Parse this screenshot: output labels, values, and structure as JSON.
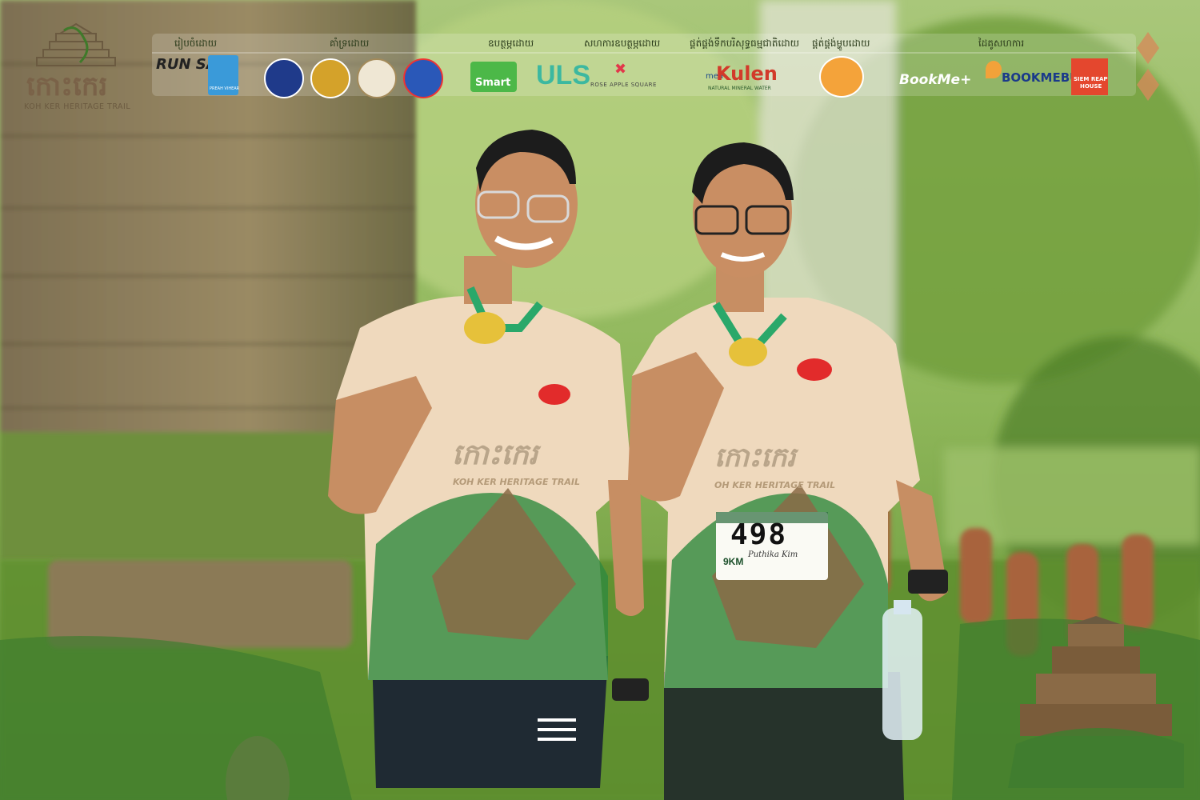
{
  "colors": {
    "forest_light": "#8fb75a",
    "forest_dark": "#3f6b2a",
    "stone": "#8a7a5a",
    "shirt": "#efd9bd",
    "shirt_green": "#2f8a3f",
    "accent_red": "#e22b2b"
  },
  "branding": {
    "title_script": "កោះកេរ",
    "subtitle": "KOH KER HERITAGE TRAIL"
  },
  "sponsor_bar": {
    "categories": [
      {
        "label": "រៀបចំដោយ"
      },
      {
        "label": "គាំទ្រដោយ"
      },
      {
        "label": "ឧបត្ថម្ភដោយ"
      },
      {
        "label": "សហការឧបត្ថម្ភដោយ"
      },
      {
        "label": "ផ្គត់ផ្គង់ទឹកបរិសុទ្ធធម្មជាតិដោយ"
      },
      {
        "label": "ផ្គត់ផ្គង់ម្ហូបដោយ"
      },
      {
        "label": "ដៃគូសហការ"
      }
    ],
    "logos": {
      "run_sai": "RUN SAI",
      "preah_vihear": "PREAH VIHEAR",
      "smart": "Smart",
      "uls": "ULS",
      "rose_apple": "ROSE APPLE SQUARE",
      "kulen": "Kulen",
      "kulen_sub": "NATURAL MINERAL WATER",
      "mea": "mea",
      "bookme": "BookMe+",
      "bookmebus": "BOOKMEBUS",
      "siem_reap_house_1": "SIEM REAP",
      "siem_reap_house_2": "HOUSE"
    }
  },
  "runners": {
    "shirt_script": "កោះកេរ",
    "shirt_trail": "KOH KER HERITAGE TRAIL",
    "right_runner_trail": "OH KER HERITAGE TRAIL",
    "bib": {
      "number": "498",
      "distance": "9KM",
      "name": "Puthika Kim"
    }
  }
}
